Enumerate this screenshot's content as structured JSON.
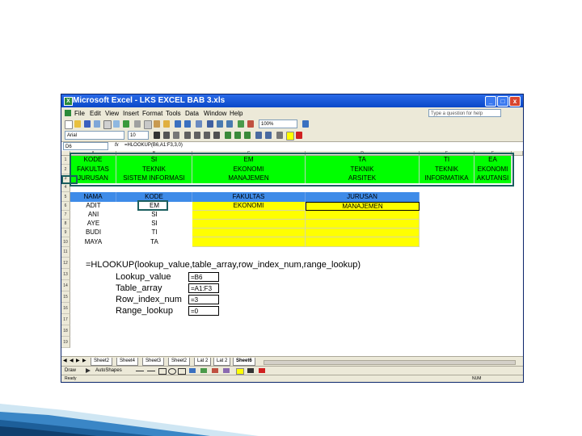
{
  "window": {
    "title": "Microsoft Excel - LKS EXCEL BAB 3.xls",
    "minimize": "_",
    "restore": "□",
    "close": "x"
  },
  "menu": [
    "File",
    "Edit",
    "View",
    "Insert",
    "Format",
    "Tools",
    "Data",
    "Window",
    "Help"
  ],
  "help_placeholder": "Type a question for help",
  "toolbar": {
    "font_name": "Arial",
    "font_size": "10",
    "zoom": "100%"
  },
  "formula_bar": {
    "name_box": "D6",
    "fx": "fx",
    "formula": "=HLOOKUP(B6,A1:F3,3,0)"
  },
  "columns": [
    "A",
    "B",
    "C",
    "D",
    "E",
    "F"
  ],
  "rows": [
    "1",
    "2",
    "3",
    "4",
    "5",
    "6",
    "7",
    "8",
    "9",
    "10",
    "11",
    "12",
    "13",
    "14",
    "15",
    "16",
    "17",
    "18",
    "19"
  ],
  "lookup_table": {
    "row1": [
      "KODE",
      "SI",
      "EM",
      "TA",
      "TI",
      "EA"
    ],
    "row2": [
      "FAKULTAS",
      "TEKNIK",
      "EKONOMI",
      "TEKNIK",
      "TEKNIK",
      "EKONOMI"
    ],
    "row3": [
      "JURUSAN",
      "SISTEM INFORMASI",
      "MANAJEMEN",
      "ARSITEK",
      "INFORMATIKA",
      "AKUTANSI"
    ]
  },
  "data_table": {
    "headers": [
      "NAMA",
      "KODE",
      "FAKULTAS",
      "JURUSAN"
    ],
    "rows": [
      [
        "ADIT",
        "EM",
        "EKONOMI",
        "MANAJEMEN"
      ],
      [
        "ANI",
        "SI",
        "",
        ""
      ],
      [
        "AYE",
        "SI",
        "",
        ""
      ],
      [
        "BUDI",
        "TI",
        "",
        ""
      ],
      [
        "MAYA",
        "TA",
        "",
        ""
      ]
    ]
  },
  "explanation": {
    "syntax": "=HLOOKUP(lookup_value,table_array,row_index_num,range_lookup)",
    "params": [
      {
        "name": "Lookup_value",
        "value": "=B6"
      },
      {
        "name": "Table_array",
        "value": "=A1:F3"
      },
      {
        "name": "Row_index_num",
        "value": "=3"
      },
      {
        "name": "Range_lookup",
        "value": "=0"
      }
    ]
  },
  "sheet_tabs": [
    "Sheet2",
    "Sheet4",
    "Sheet3",
    "Sheet2",
    "Lat 2",
    "Lat 2",
    "Sheet6"
  ],
  "draw_bar": {
    "draw": "Draw",
    "autoshapes": "AutoShapes"
  },
  "status": {
    "ready": "Ready",
    "num": "NUM"
  },
  "colors": {
    "title_bar": "#0a48c8",
    "green_fill": "#00ff00",
    "yellow_fill": "#ffff00",
    "blue_header": "#3e8be8",
    "callout": "#1b5f5f"
  }
}
